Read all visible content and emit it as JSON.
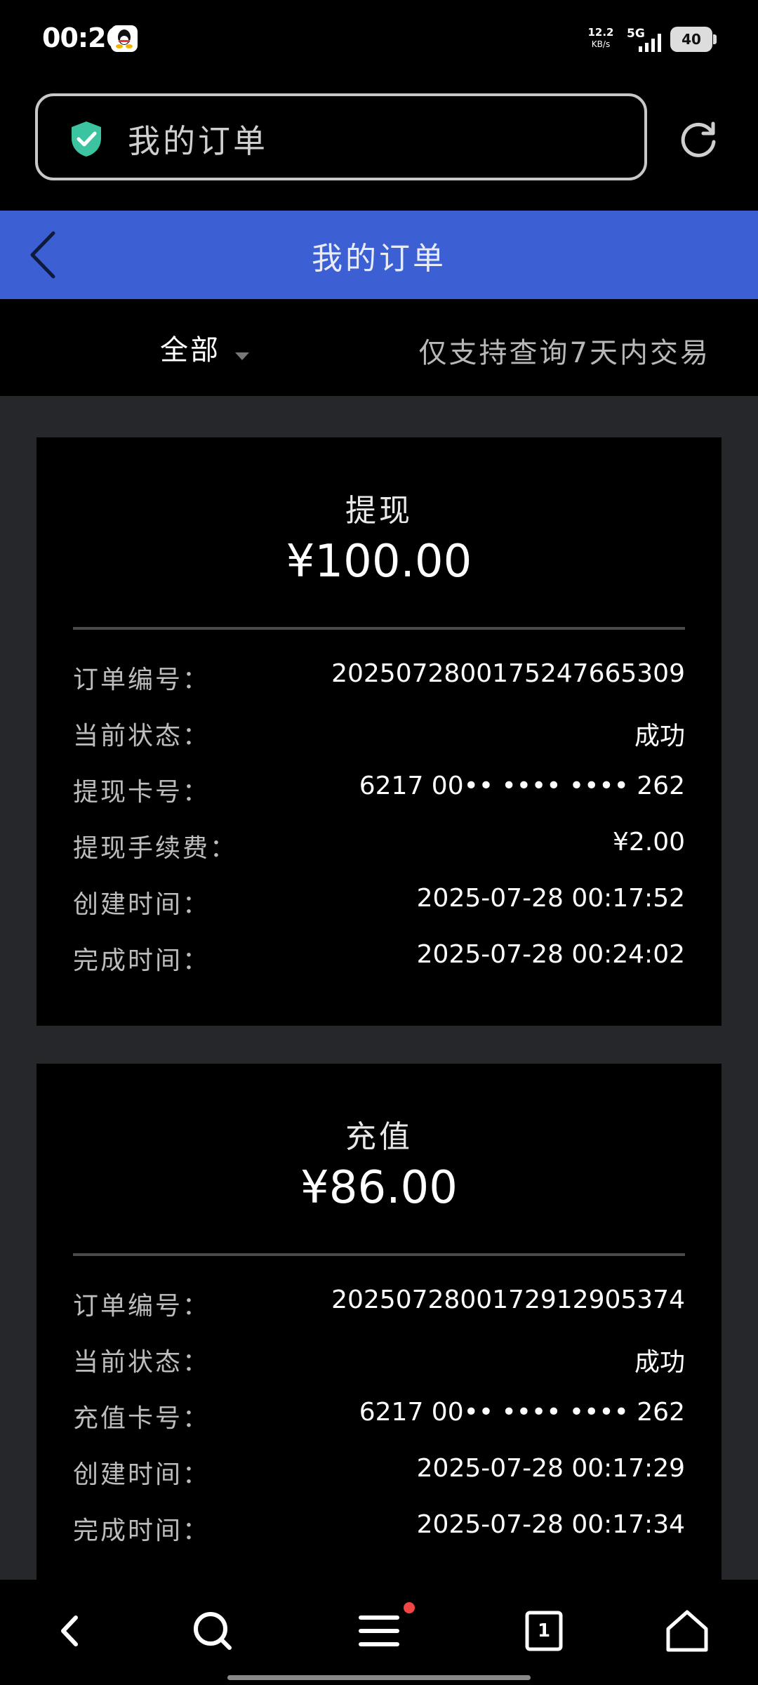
{
  "status_bar": {
    "time": "00:26",
    "net_speed_value": "12.2",
    "net_speed_unit": "KB/s",
    "network": "5G",
    "battery": "40"
  },
  "browser": {
    "address_text": "我的订单",
    "security_icon": "shield-check-icon",
    "refresh_icon": "refresh-icon",
    "accent_color": "#3cc4a0"
  },
  "header": {
    "title": "我的订单",
    "back_icon": "chevron-left-icon",
    "background_color": "#3c60d4"
  },
  "filter": {
    "selected": "全部",
    "note": "仅支持查询7天内交易"
  },
  "orders": [
    {
      "type": "提现",
      "amount": "¥100.00",
      "details": [
        {
          "label": "订单编号：",
          "value": "2025072800175247665309"
        },
        {
          "label": "当前状态：",
          "value": "成功"
        },
        {
          "label": "提现卡号：",
          "value": "6217 00•• •••• •••• 262"
        },
        {
          "label": "提现手续费：",
          "value": "¥2.00"
        },
        {
          "label": "创建时间：",
          "value": "2025-07-28 00:17:52"
        },
        {
          "label": "完成时间：",
          "value": "2025-07-28 00:24:02"
        }
      ]
    },
    {
      "type": "充值",
      "amount": "¥86.00",
      "details": [
        {
          "label": "订单编号：",
          "value": "2025072800172912905374"
        },
        {
          "label": "当前状态：",
          "value": "成功"
        },
        {
          "label": "充值卡号：",
          "value": "6217 00•• •••• •••• 262"
        },
        {
          "label": "创建时间：",
          "value": "2025-07-28 00:17:29"
        },
        {
          "label": "完成时间：",
          "value": "2025-07-28 00:17:34"
        }
      ]
    }
  ],
  "bottom_nav": {
    "items": [
      "back-icon",
      "search-icon",
      "menu-icon",
      "tabs-icon",
      "home-icon"
    ],
    "tab_count": "1",
    "notification_color": "#f04545"
  }
}
